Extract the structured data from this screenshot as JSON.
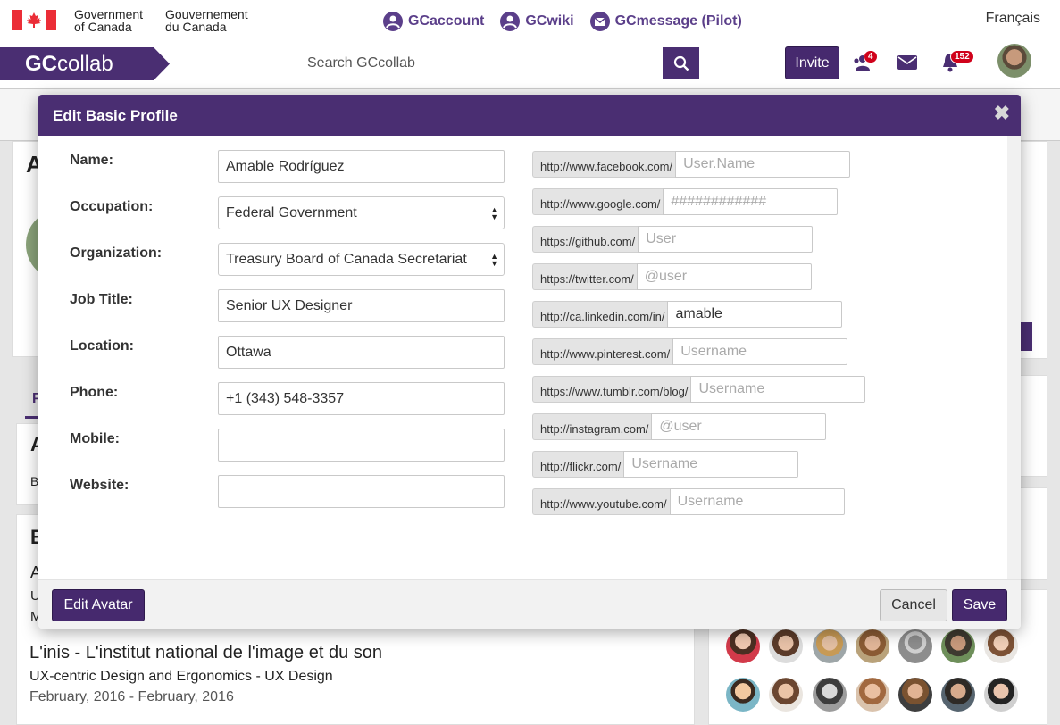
{
  "gov": {
    "en_line1": "Government",
    "en_line2": "of Canada",
    "fr_line1": "Gouvernement",
    "fr_line2": "du Canada",
    "language_link": "Français"
  },
  "apps": [
    {
      "label": "GCaccount",
      "icon": "gcaccount-icon"
    },
    {
      "label": "GCwiki",
      "icon": "gcwiki-icon"
    },
    {
      "label": "GCmessage (Pilot)",
      "icon": "gcmessage-icon"
    }
  ],
  "header": {
    "brand_bold": "GC",
    "brand_light": "collab",
    "search_placeholder": "Search GCcollab",
    "invite_label": "Invite",
    "colleague_requests_count": "4",
    "notifications_count": "152"
  },
  "modal": {
    "title": "Edit Basic Profile",
    "close_glyph": "✖",
    "fields": [
      {
        "label": "Name:",
        "value": "Amable Rodríguez",
        "type": "text"
      },
      {
        "label": "Occupation:",
        "value": "Federal Government",
        "type": "select"
      },
      {
        "label": "Organization:",
        "value": "Treasury Board of Canada Secretariat",
        "type": "select"
      },
      {
        "label": "Job Title:",
        "value": "Senior UX Designer",
        "type": "text"
      },
      {
        "label": "Location:",
        "value": "Ottawa",
        "type": "text"
      },
      {
        "label": "Phone:",
        "value": "+1 (343) 548-3357",
        "type": "text"
      },
      {
        "label": "Mobile:",
        "value": "",
        "type": "text"
      },
      {
        "label": "Website:",
        "value": "",
        "type": "text"
      }
    ],
    "social": [
      {
        "prefix": "http://www.facebook.com/",
        "value": "",
        "placeholder": "User.Name"
      },
      {
        "prefix": "http://www.google.com/",
        "value": "",
        "placeholder": "############"
      },
      {
        "prefix": "https://github.com/",
        "value": "",
        "placeholder": "User"
      },
      {
        "prefix": "https://twitter.com/",
        "value": "",
        "placeholder": "@user"
      },
      {
        "prefix": "http://ca.linkedin.com/in/",
        "value": "amable",
        "placeholder": ""
      },
      {
        "prefix": "http://www.pinterest.com/",
        "value": "",
        "placeholder": "Username"
      },
      {
        "prefix": "https://www.tumblr.com/blog/",
        "value": "",
        "placeholder": "Username"
      },
      {
        "prefix": "http://instagram.com/",
        "value": "",
        "placeholder": "@user"
      },
      {
        "prefix": "http://flickr.com/",
        "value": "",
        "placeholder": "Username"
      },
      {
        "prefix": "http://www.youtube.com/",
        "value": "",
        "placeholder": "Username"
      }
    ],
    "edit_avatar_label": "Edit Avatar",
    "cancel_label": "Cancel",
    "save_label": "Save"
  },
  "background": {
    "profile_initial": "A",
    "about_initial": "A",
    "about_text_initial": "B",
    "education_initial": "E",
    "education_entry_initial": "A",
    "education_line_u": "U",
    "education_line_m": "M",
    "tab_initial": "P",
    "education_title": "L'inis - L'institut national de l'image et du son",
    "education_program": "UX-centric Design and Ergonomics - UX Design",
    "education_dates": "February, 2016 - February, 2016"
  },
  "colors": {
    "brand_purple": "#4a2e72",
    "badge_red": "#d0021b",
    "canada_red": "#eb2d37"
  }
}
